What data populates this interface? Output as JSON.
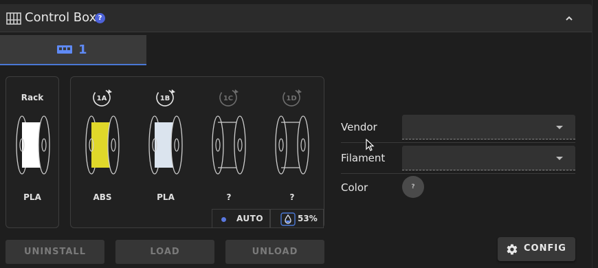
{
  "header": {
    "title": "Control Box",
    "help_icon": "?",
    "icon": "control-box-icon",
    "collapse_icon": "chevron-up-icon"
  },
  "tabs": [
    {
      "label": "1",
      "icon": "unit-icon"
    }
  ],
  "rack": {
    "label": "Rack",
    "material": "PLA",
    "color": "#ffffff"
  },
  "tools": [
    {
      "badge": "1A",
      "material": "ABS",
      "color": "#e0d82a",
      "active": true
    },
    {
      "badge": "1B",
      "material": "PLA",
      "color": "#dbe4ee",
      "active": true
    },
    {
      "badge": "1C",
      "material": "?",
      "color": null,
      "active": false
    },
    {
      "badge": "1D",
      "material": "?",
      "color": null,
      "active": false
    }
  ],
  "status": {
    "mode": "AUTO",
    "humidity": "53%",
    "accent": "#4a78d6"
  },
  "form": {
    "vendor_label": "Vendor",
    "vendor_value": "",
    "filament_label": "Filament",
    "filament_value": "",
    "color_label": "Color",
    "color_value": "?"
  },
  "buttons": {
    "uninstall": "UNINSTALL",
    "load": "LOAD",
    "unload": "UNLOAD",
    "config": "CONFIG"
  }
}
